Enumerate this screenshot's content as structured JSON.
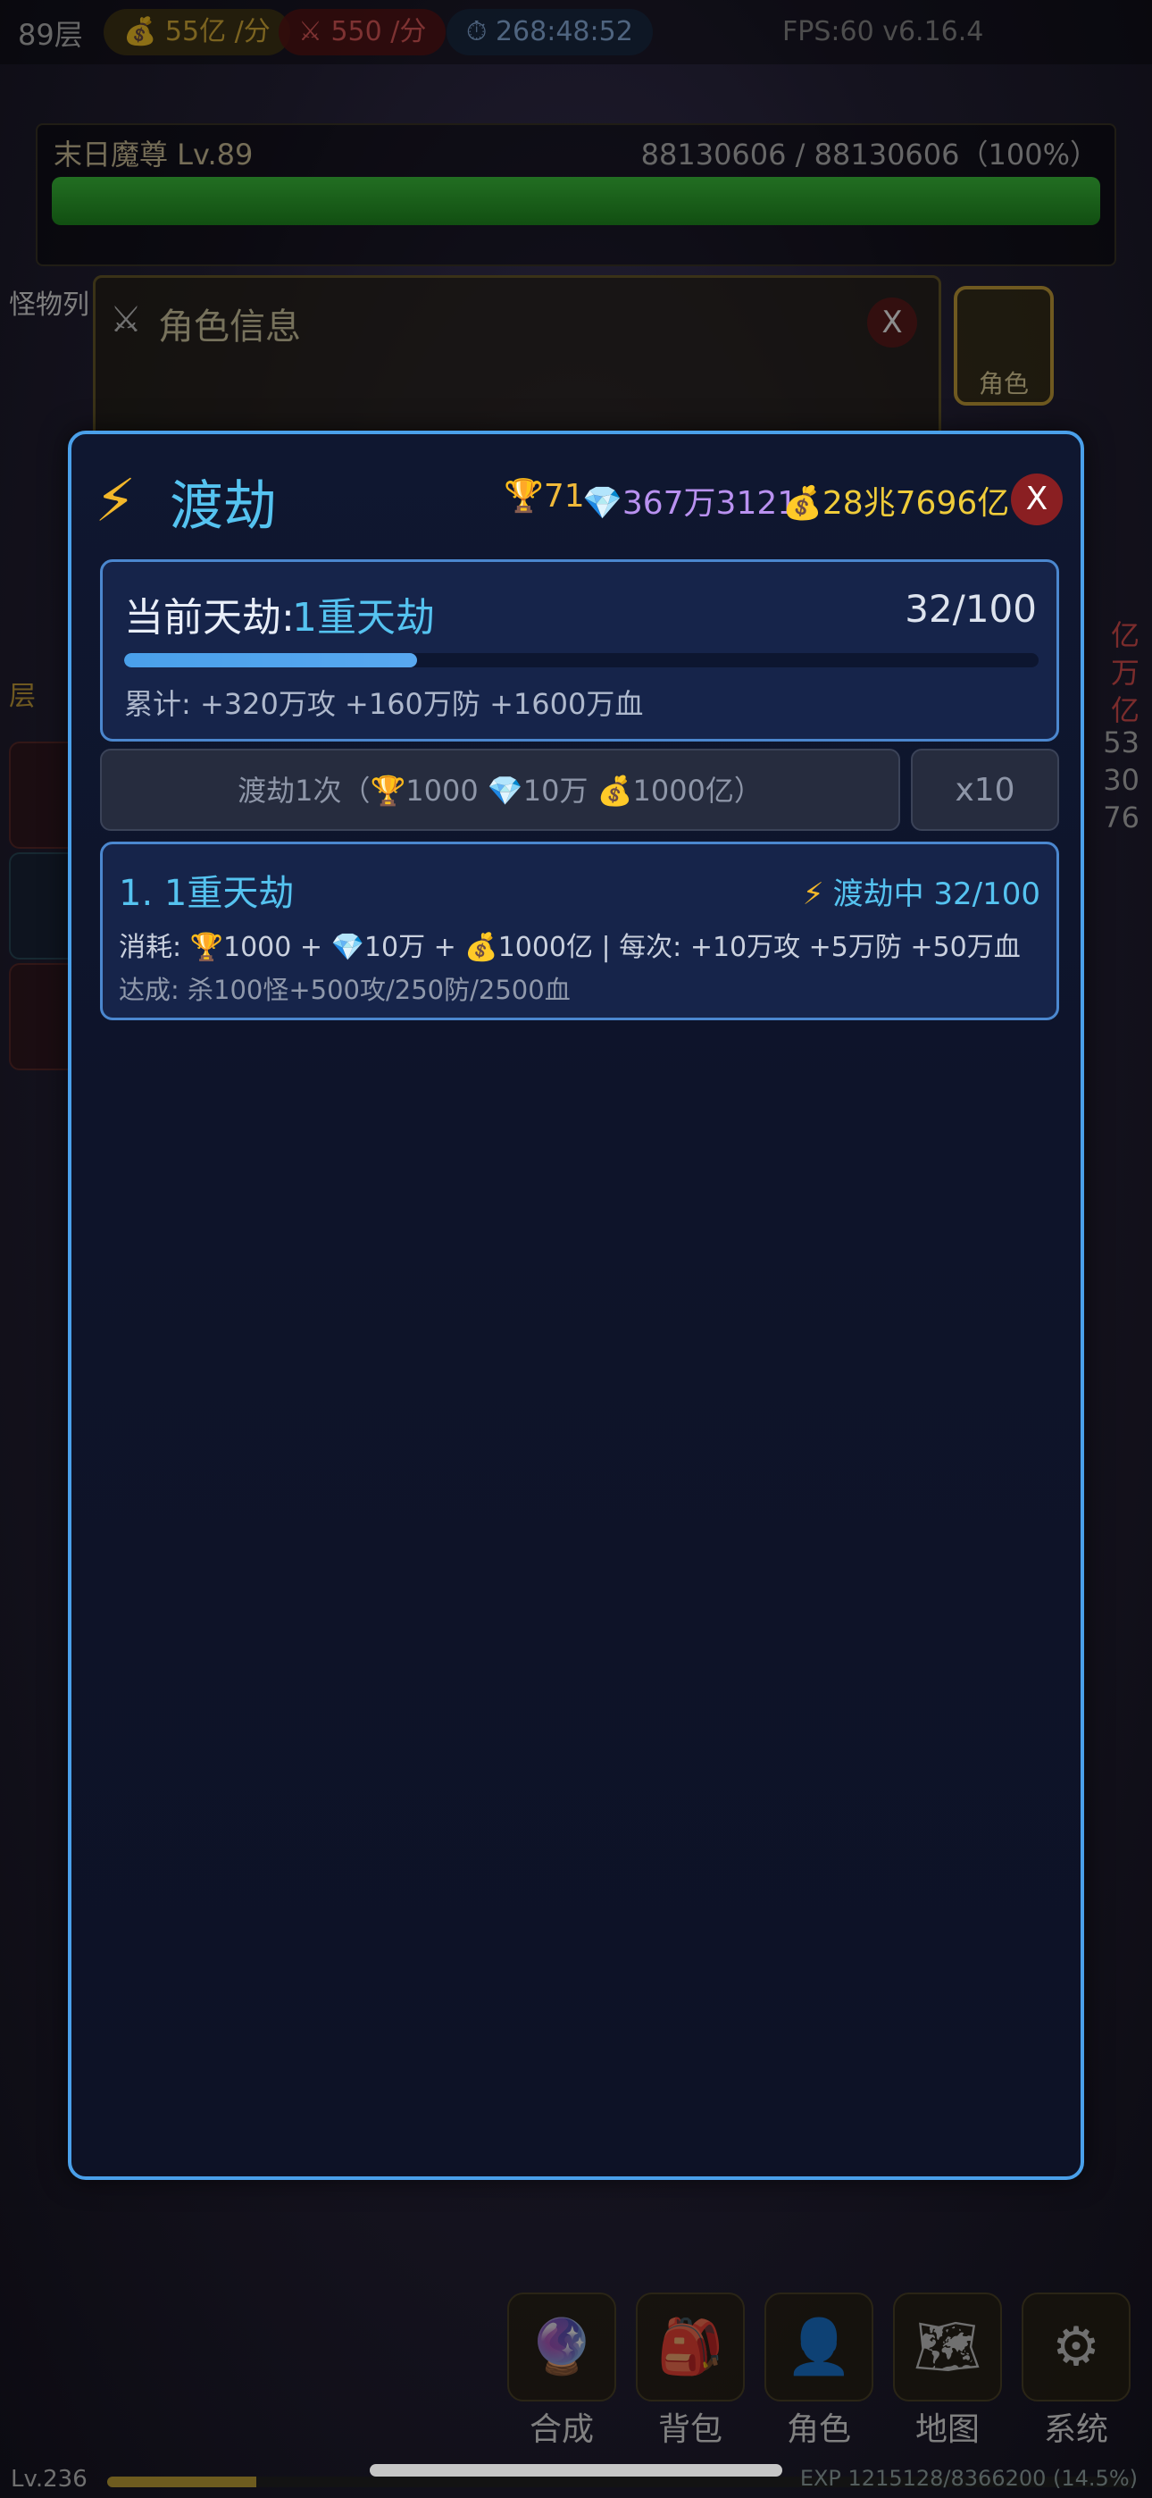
{
  "top_bar": {
    "floor": "89层",
    "gold_rate": "55亿",
    "gold_rate_unit": "/分",
    "atk_rate": "550",
    "atk_rate_unit": "/分",
    "timer": "268:48:52",
    "fps": "FPS:60 v6.16.4"
  },
  "boss": {
    "name": "末日魔尊 Lv.89",
    "hp_text": "88130606 / 88130606（100%）",
    "hp_fraction": 1.0
  },
  "left_sidebar": {
    "tab_label": "怪物列",
    "floor_label": "层"
  },
  "character_panel": {
    "title": "角色信息",
    "close": "X",
    "side_button": "角色"
  },
  "right_sidebar": {
    "values": [
      "亿",
      "万",
      "亿",
      "53",
      "30",
      "76"
    ]
  },
  "modal": {
    "title": "渡劫",
    "resources": {
      "trophy": "71",
      "gem": "367万3121",
      "gold": "28兆7696亿"
    },
    "close": "X",
    "current": {
      "label": "当前天劫:",
      "value": "1重天劫",
      "count": "32/100",
      "progress": 0.32,
      "total": "累计: +320万攻 +160万防 +1600万血"
    },
    "btn_once": "渡劫1次（🏆1000 💎10万 💰1000亿）",
    "btn_ten": "x10",
    "stages": [
      {
        "title": "1. 1重天劫",
        "status": "渡劫中 32/100",
        "cost": "消耗: 🏆1000 + 💎10万 + 💰1000亿 | 每次: +10万攻 +5万防 +50万血",
        "reward": "达成: 杀100怪+500攻/250防/2500血"
      }
    ]
  },
  "bottom_nav": {
    "items": [
      {
        "label": "合成",
        "icon": "crystal-ball-icon"
      },
      {
        "label": "背包",
        "icon": "backpack-icon"
      },
      {
        "label": "角色",
        "icon": "user-icon"
      },
      {
        "label": "地图",
        "icon": "map-icon"
      },
      {
        "label": "系统",
        "icon": "gear-icon"
      }
    ]
  },
  "footer": {
    "level": "Lv.236",
    "exp": "EXP 1215128/8366200 (14.5%)",
    "exp_fraction": 0.145
  },
  "colors": {
    "accent": "#55c3f0",
    "modal_border": "#4aa0ea",
    "gold": "#f0cc3a",
    "gem": "#b991f0",
    "close_red": "#8a1f22"
  }
}
